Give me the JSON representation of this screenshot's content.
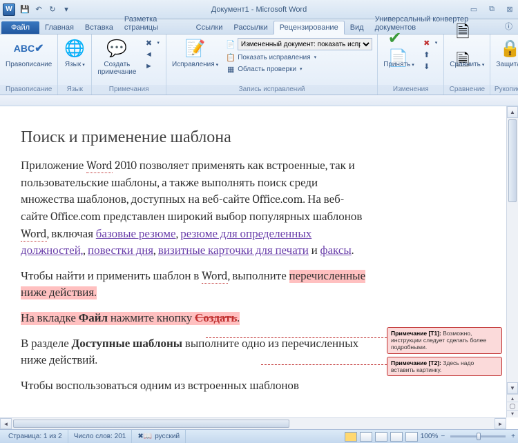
{
  "title": "Документ1 - Microsoft Word",
  "qat": {
    "icon_app": "W"
  },
  "tabs": {
    "file": "Файл",
    "items": [
      "Главная",
      "Вставка",
      "Разметка страницы",
      "Ссылки",
      "Рассылки",
      "Рецензирование",
      "Вид",
      "Универсальный конвертер документов"
    ],
    "active": 5
  },
  "ribbon": {
    "proofing": {
      "spelling": "Правописание",
      "label": "Правописание"
    },
    "language": {
      "btn": "Язык",
      "label": "Язык"
    },
    "comments": {
      "new": "Создать\nпримечание",
      "label": "Примечания"
    },
    "tracking": {
      "track": "Исправления",
      "display": "Измененный документ: показать исправления",
      "show": "Показать исправления",
      "pane": "Область проверки",
      "label": "Запись исправлений"
    },
    "changes": {
      "accept": "Принять",
      "label": "Изменения"
    },
    "compare": {
      "btn": "Сравнить",
      "label": "Сравнение"
    },
    "protect": {
      "btn": "Защита",
      "label": "Рукопис..."
    }
  },
  "doc": {
    "heading": "Поиск и применение шаблона",
    "p1a": "Приложение ",
    "p1_word": "Word",
    "p1b": " 2010 позволяет применять как встроенные, так и пользовательские шаблоны, а также выполнять поиск среди множества шаблонов, доступных на веб-сайте Office.com. На веб-сайте Office.com представлен широкий выбор популярных шаблонов ",
    "p1_word2": "Word",
    "p1c": ", включая ",
    "l1": "базовые резюме",
    "p1d": ", ",
    "l2": "резюме для определенных должностей,",
    "p1e": ", ",
    "l3": "повестки дня",
    "p1f": ", ",
    "l4": "визитные карточки для печати",
    "p1g": " и ",
    "l5": "факсы",
    "p1h": ".",
    "p2a": "Чтобы найти и применить шаблон в ",
    "p2_word": "Word",
    "p2b": ", выполните ",
    "p2_hl": "перечисленные ниже действия.",
    "p3a": "На вкладке ",
    "p3b": "Файл",
    "p3c": " нажмите кнопку ",
    "p3d": "Создать",
    "p3e": ".",
    "p4a": "В разделе ",
    "p4b": "Доступные шаблоны",
    "p4c": " выполните одно из перечисленных ниже действий.",
    "p5": "Чтобы воспользоваться одним из встроенных шаблонов"
  },
  "comments_pane": {
    "c1_label": "Примечание [T1]:",
    "c1_text": " Возможно, инструкции следует сделать более подробными.",
    "c2_label": "Примечание [T2]:",
    "c2_text": " Здесь надо вставить картинку."
  },
  "status": {
    "page": "Страница: 1 из 2",
    "words": "Число слов: 201",
    "lang": "русский",
    "zoom": "100%"
  }
}
